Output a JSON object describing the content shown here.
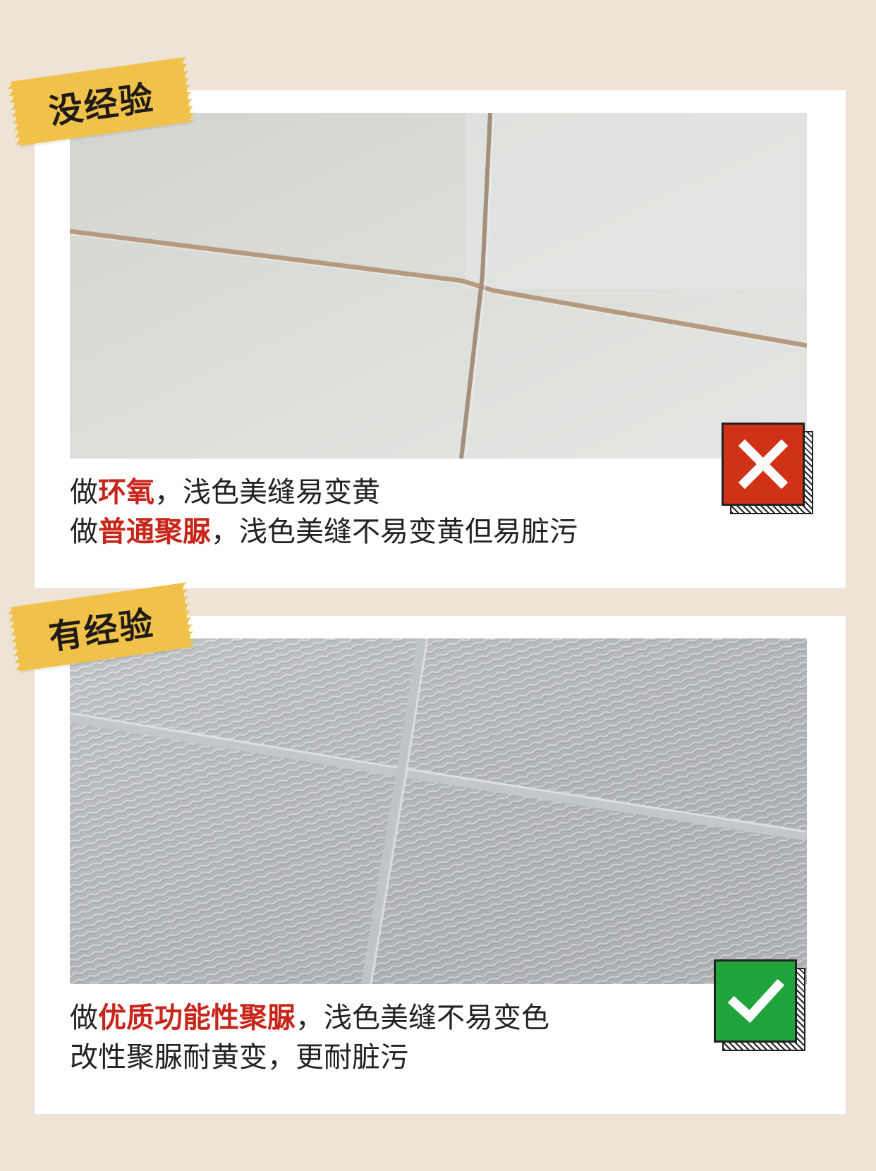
{
  "sections": [
    {
      "tag": "没经验",
      "lines": [
        {
          "prefix": "做",
          "highlight": "环氧",
          "suffix": "，浅色美缝易变黄"
        },
        {
          "prefix": "做",
          "highlight": "普通聚脲",
          "suffix": "，浅色美缝不易变黄但易脏污"
        }
      ],
      "badge_icon": "x-icon",
      "badge_color": "#cf3216"
    },
    {
      "tag": "有经验",
      "lines": [
        {
          "prefix": "做",
          "highlight": "优质功能性聚脲",
          "suffix": "，浅色美缝不易变色"
        },
        {
          "prefix": "改性聚脲耐黄变，更耐脏污",
          "highlight": "",
          "suffix": ""
        }
      ],
      "badge_icon": "checkmark-icon",
      "badge_color": "#1ea43a"
    }
  ],
  "colors": {
    "background": "#ede3d6",
    "tag": "#f1c24a",
    "highlight": "#c8261a"
  }
}
